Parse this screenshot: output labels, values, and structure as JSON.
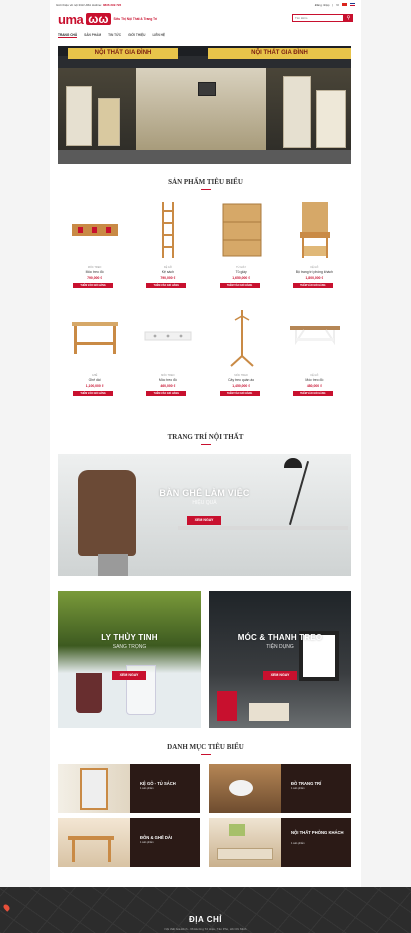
{
  "topbar": {
    "left_text": "Giới thiệu về nội thất UMA",
    "hotline_label": "Hotline:",
    "hotline": "0836 299 722",
    "account": "Đăng nhập",
    "divider": "|",
    "lang": "VI"
  },
  "header": {
    "logo_text": "uma",
    "logo_sub": "Siêu Thị Nội Thất & Trang Trí",
    "search_placeholder": "Tìm kiếm"
  },
  "nav": [
    "TRANG CHỦ",
    "SẢN PHẨM",
    "TIN TỨC",
    "GIỚI THIỆU",
    "LIÊN HỆ"
  ],
  "hero": {
    "sign1": "NỘI THẤT GIA ĐÌNH",
    "sign2": "NỘI THẤT GIA ĐÌNH"
  },
  "featured": {
    "title": "SẢN PHẨM TIÊU BIỂU",
    "buy_label": "THÊM VÀO GIỎ HÀNG",
    "products": [
      {
        "cat": "MÓC TREO",
        "name": "Móc treo đồ",
        "price": "790,000 ₫",
        "kind": "hook"
      },
      {
        "cat": "KỆ GỖ",
        "name": "Kệ sách",
        "price": "790,000 ₫",
        "kind": "shelf"
      },
      {
        "cat": "TỦ GIÀY",
        "name": "Tủ giày",
        "price": "1,650,000 ₫",
        "kind": "cabinet"
      },
      {
        "cat": "KỆ GỖ",
        "name": "Bộ trang trí phòng khách",
        "price": "1,800,000 ₫",
        "kind": "hall"
      },
      {
        "cat": "GHẾ",
        "name": "Ghế dài",
        "price": "1,100,000 ₫",
        "kind": "bench"
      },
      {
        "cat": "MÓC TREO",
        "name": "Móc treo đồ",
        "price": "460,000 ₫",
        "kind": "rack"
      },
      {
        "cat": "MÓC TREO",
        "name": "Cây treo quần áo",
        "price": "1,450,000 ₫",
        "kind": "tree"
      },
      {
        "cat": "KỆ GỖ",
        "name": "Móc treo đồ",
        "price": "480,000 ₫",
        "kind": "wallshelf"
      }
    ]
  },
  "decor": {
    "title": "TRANG TRÍ NỘI THẤT",
    "main_banner": {
      "caption": "BÀN GHẾ LÀM VIỆC",
      "sub": "HIỆU QUẢ",
      "button": "XEM NGAY"
    },
    "banner_left": {
      "caption": "LY THỦY TINH",
      "sub": "SANG TRỌNG",
      "button": "XEM NGAY"
    },
    "banner_right": {
      "caption": "MÓC & THANH TREO",
      "sub": "TIỆN DỤNG",
      "button": "XEM NGAY"
    }
  },
  "categories": {
    "title": "DANH MỤC TIÊU BIỂU",
    "items": [
      {
        "label": "KỆ GỖ - TỦ SÁCH",
        "count": "1 sản phẩm"
      },
      {
        "label": "ĐỒ TRANG TRÍ",
        "count": "1 sản phẩm"
      },
      {
        "label": "ĐÔN & GHẾ DÀI",
        "count": "1 sản phẩm"
      },
      {
        "label": "NỘI THẤT PHÒNG KHÁCH",
        "count": "1 sản phẩm"
      }
    ]
  },
  "footer": {
    "title": "ĐỊA CHỈ",
    "address": "Nội thất Gia Đình - 66 Đường Tô Hiệu, Tân Phú, Hồ Chí Minh"
  },
  "colors": {
    "accent": "#c8102e",
    "dark": "#2b1a16"
  }
}
